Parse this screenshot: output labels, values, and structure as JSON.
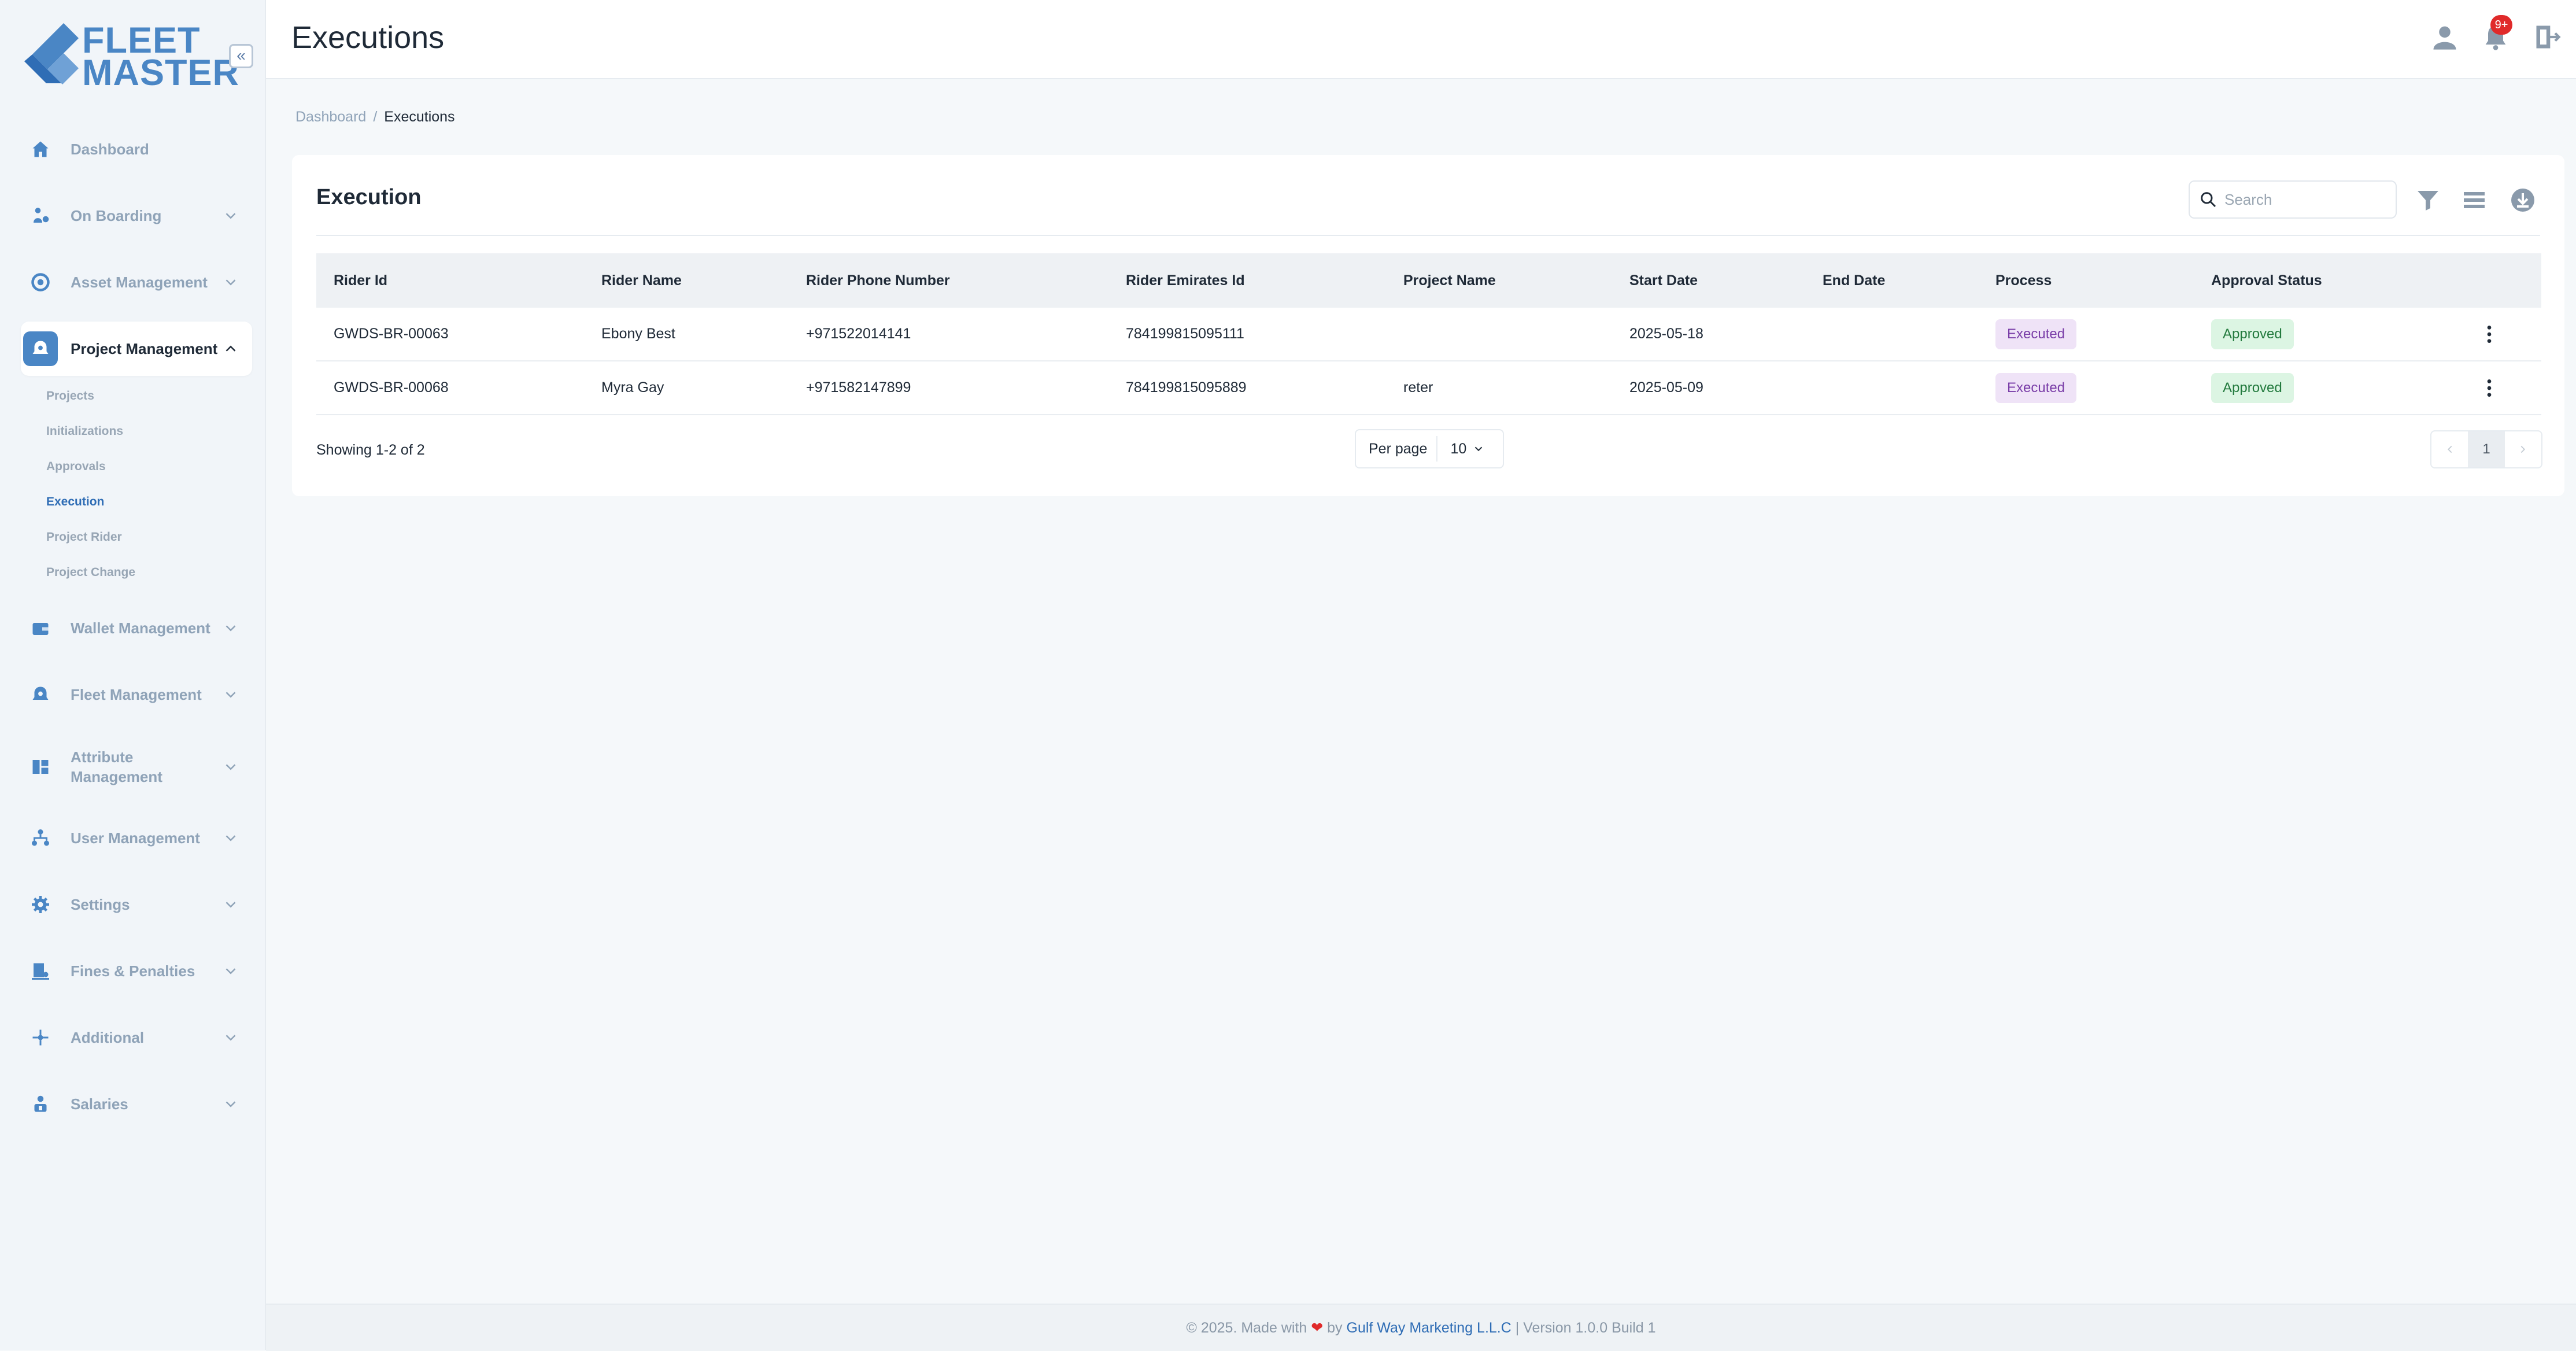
{
  "brand": {
    "line1": "FLEET",
    "line2": "MASTER"
  },
  "sidebar": {
    "items": [
      {
        "label": "Dashboard",
        "icon": "home-icon"
      },
      {
        "label": "On Boarding",
        "icon": "onboarding-icon"
      },
      {
        "label": "Asset Management",
        "icon": "asset-icon"
      },
      {
        "label": "Project Management",
        "icon": "project-icon",
        "active": true,
        "children": [
          "Projects",
          "Initializations",
          "Approvals",
          "Execution",
          "Project Rider",
          "Project Change"
        ],
        "active_child": "Execution"
      },
      {
        "label": "Wallet Management",
        "icon": "wallet-icon"
      },
      {
        "label": "Fleet Management",
        "icon": "fleet-icon"
      },
      {
        "label": "Attribute\nManagement",
        "icon": "attribute-icon"
      },
      {
        "label": "User Management",
        "icon": "users-icon"
      },
      {
        "label": "Settings",
        "icon": "gear-icon"
      },
      {
        "label": "Fines & Penalties",
        "icon": "fines-icon"
      },
      {
        "label": "Additional",
        "icon": "additional-icon"
      },
      {
        "label": "Salaries",
        "icon": "salaries-icon"
      }
    ]
  },
  "header": {
    "title": "Executions",
    "notification_badge": "9+"
  },
  "breadcrumb": {
    "home": "Dashboard",
    "separator": "/",
    "current": "Executions"
  },
  "card": {
    "title": "Execution",
    "search_placeholder": "Search",
    "columns": [
      "Rider Id",
      "Rider Name",
      "Rider Phone Number",
      "Rider Emirates Id",
      "Project Name",
      "Start Date",
      "End Date",
      "Process",
      "Approval Status"
    ],
    "rows": [
      {
        "rider_id": "GWDS-BR-00063",
        "rider_name": "Ebony Best",
        "phone": "+971522014141",
        "emirates_id": "784199815095111",
        "project": "",
        "start": "2025-05-18",
        "end": "",
        "process": "Executed",
        "approval": "Approved"
      },
      {
        "rider_id": "GWDS-BR-00068",
        "rider_name": "Myra Gay",
        "phone": "+971582147899",
        "emirates_id": "784199815095889",
        "project": "reter",
        "start": "2025-05-09",
        "end": "",
        "process": "Executed",
        "approval": "Approved"
      }
    ],
    "showing": "Showing 1-2 of 2",
    "per_page_label": "Per page",
    "per_page_value": "10",
    "current_page": "1"
  },
  "footer": {
    "prefix": "© 2025. Made with",
    "heart": "❤",
    "by": "by",
    "company": "Gulf Way Marketing L.L.C",
    "suffix": "| Version 1.0.0 Build 1"
  },
  "colors": {
    "accent": "#4a86c5",
    "link": "#2f6db5",
    "badge": "#e02a2a",
    "process_bg": "#efe3f7",
    "approval_bg": "#dcf5e3"
  }
}
